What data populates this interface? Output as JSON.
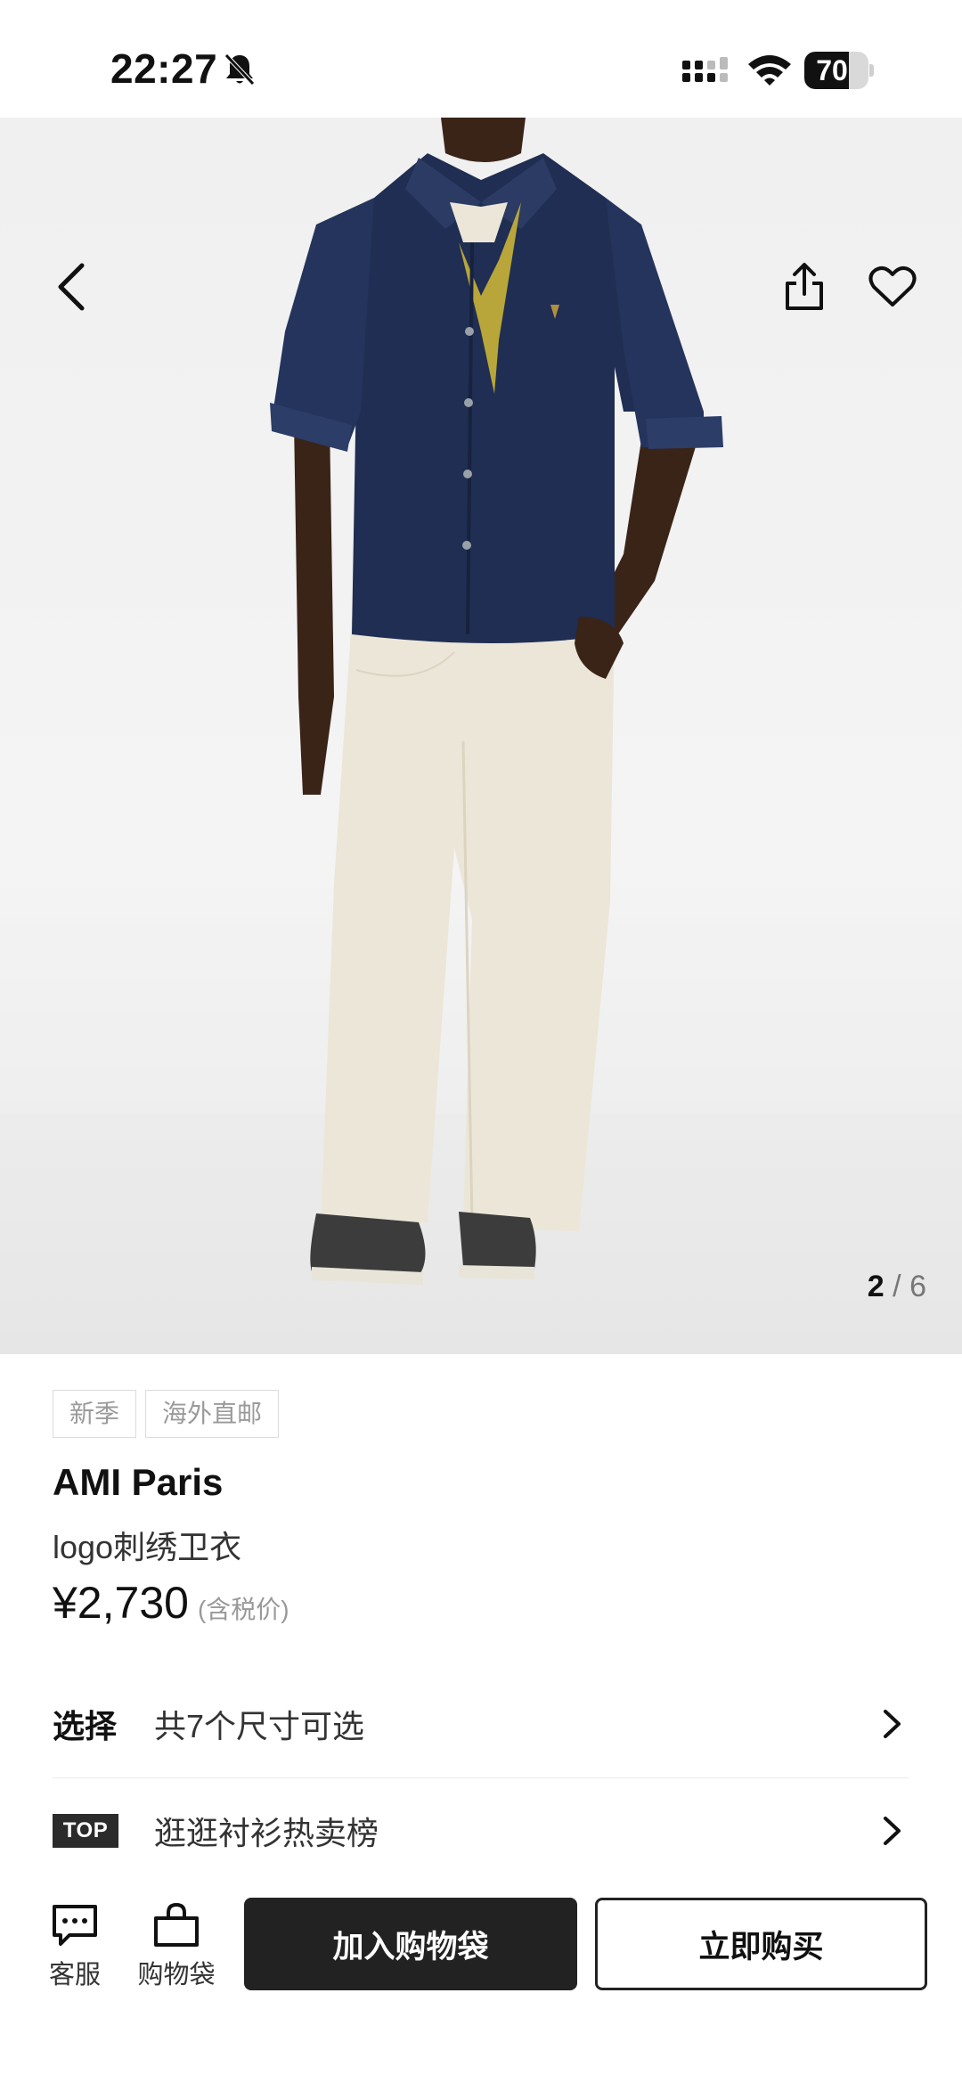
{
  "status_bar": {
    "time": "22:27",
    "battery_percent": "70",
    "battery_level": 0.7,
    "icons": [
      "bell-muted-icon",
      "signal-icon",
      "wifi-icon",
      "battery-icon"
    ]
  },
  "header": {
    "icons": [
      "back-arrow-icon",
      "share-icon",
      "heart-icon"
    ]
  },
  "gallery": {
    "current": "2",
    "separator": "/",
    "total": "6"
  },
  "tags": [
    "新季",
    "海外直邮"
  ],
  "product": {
    "brand": "AMI Paris",
    "name": "logo刺绣卫衣",
    "price": "¥2,730",
    "tax_note": "(含税价)"
  },
  "options": {
    "size_label": "选择",
    "size_text": "共7个尺寸可选",
    "top_badge": "TOP",
    "top_text": "逛逛衬衫热卖榜"
  },
  "bottom_bar": {
    "customer_service": "客服",
    "shopping_bag": "购物袋",
    "add_to_bag": "加入购物袋",
    "buy_now": "立即购买"
  },
  "colors": {
    "primary_button": "#222222",
    "background": "#ffffff",
    "tag_border": "#dcdcdc"
  }
}
